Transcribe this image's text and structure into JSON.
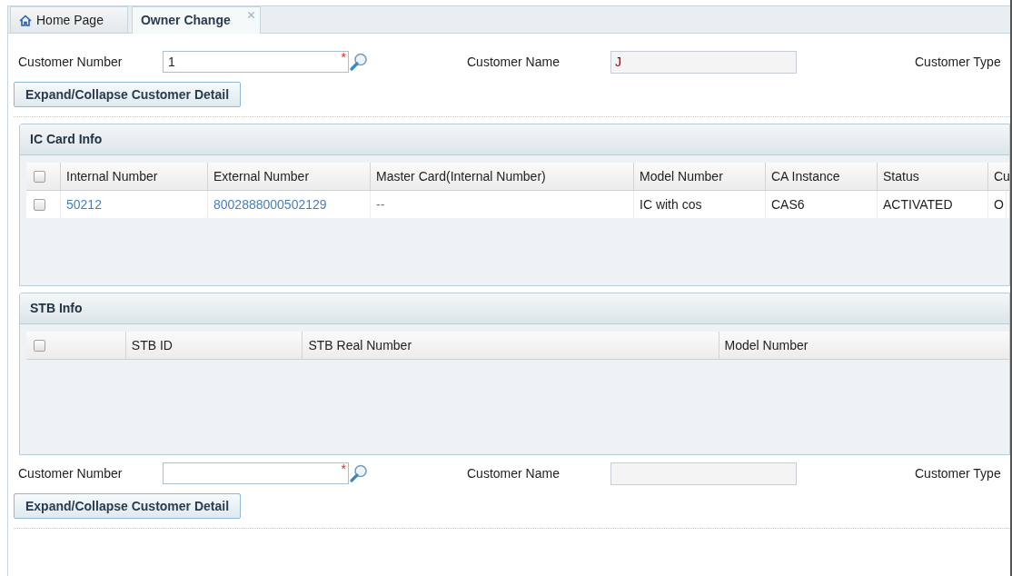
{
  "tabs": [
    {
      "label": "Home Page",
      "kind": "home",
      "selected": false,
      "closable": false
    },
    {
      "label": "Owner Change",
      "selected": true,
      "closable": true
    }
  ],
  "blocks": [
    {
      "kind": "customer",
      "fields": [
        {
          "kind": "search",
          "label": "Customer Number",
          "value": "1",
          "required_mark": "*"
        },
        {
          "kind": "readonly",
          "label": "Customer Name",
          "value": "J"
        },
        {
          "kind": "label_only",
          "label": "Customer Type"
        }
      ],
      "button": "Expand/Collapse Customer Detail"
    },
    {
      "kind": "panel",
      "title": "IC Card Info",
      "header_checked": false,
      "columns": [
        "Internal Number",
        "External Number",
        "Master Card(Internal Number)",
        "Model Number",
        "CA Instance",
        "Status",
        "Cu"
      ],
      "rows": [
        {
          "checked": false,
          "cells": [
            {
              "text": "50212",
              "link": true
            },
            {
              "text": "8002888000502129",
              "link": true
            },
            {
              "text": "--",
              "link": true
            },
            {
              "text": "IC with cos",
              "link": false
            },
            {
              "text": "CAS6",
              "link": false
            },
            {
              "text": "ACTIVATED",
              "link": false
            },
            {
              "text": "O",
              "link": false
            }
          ]
        }
      ]
    },
    {
      "kind": "panel",
      "title": "STB Info",
      "header_checked": false,
      "columns": [
        "STB ID",
        "STB Real Number",
        "Model Number"
      ]
    },
    {
      "kind": "customer",
      "fields": [
        {
          "kind": "search",
          "label": "Customer Number",
          "required_mark": "*"
        },
        {
          "kind": "readonly",
          "label": "Customer Name"
        },
        {
          "kind": "label_only",
          "label": "Customer Type"
        }
      ],
      "button": "Expand/Collapse Customer Detail"
    }
  ]
}
